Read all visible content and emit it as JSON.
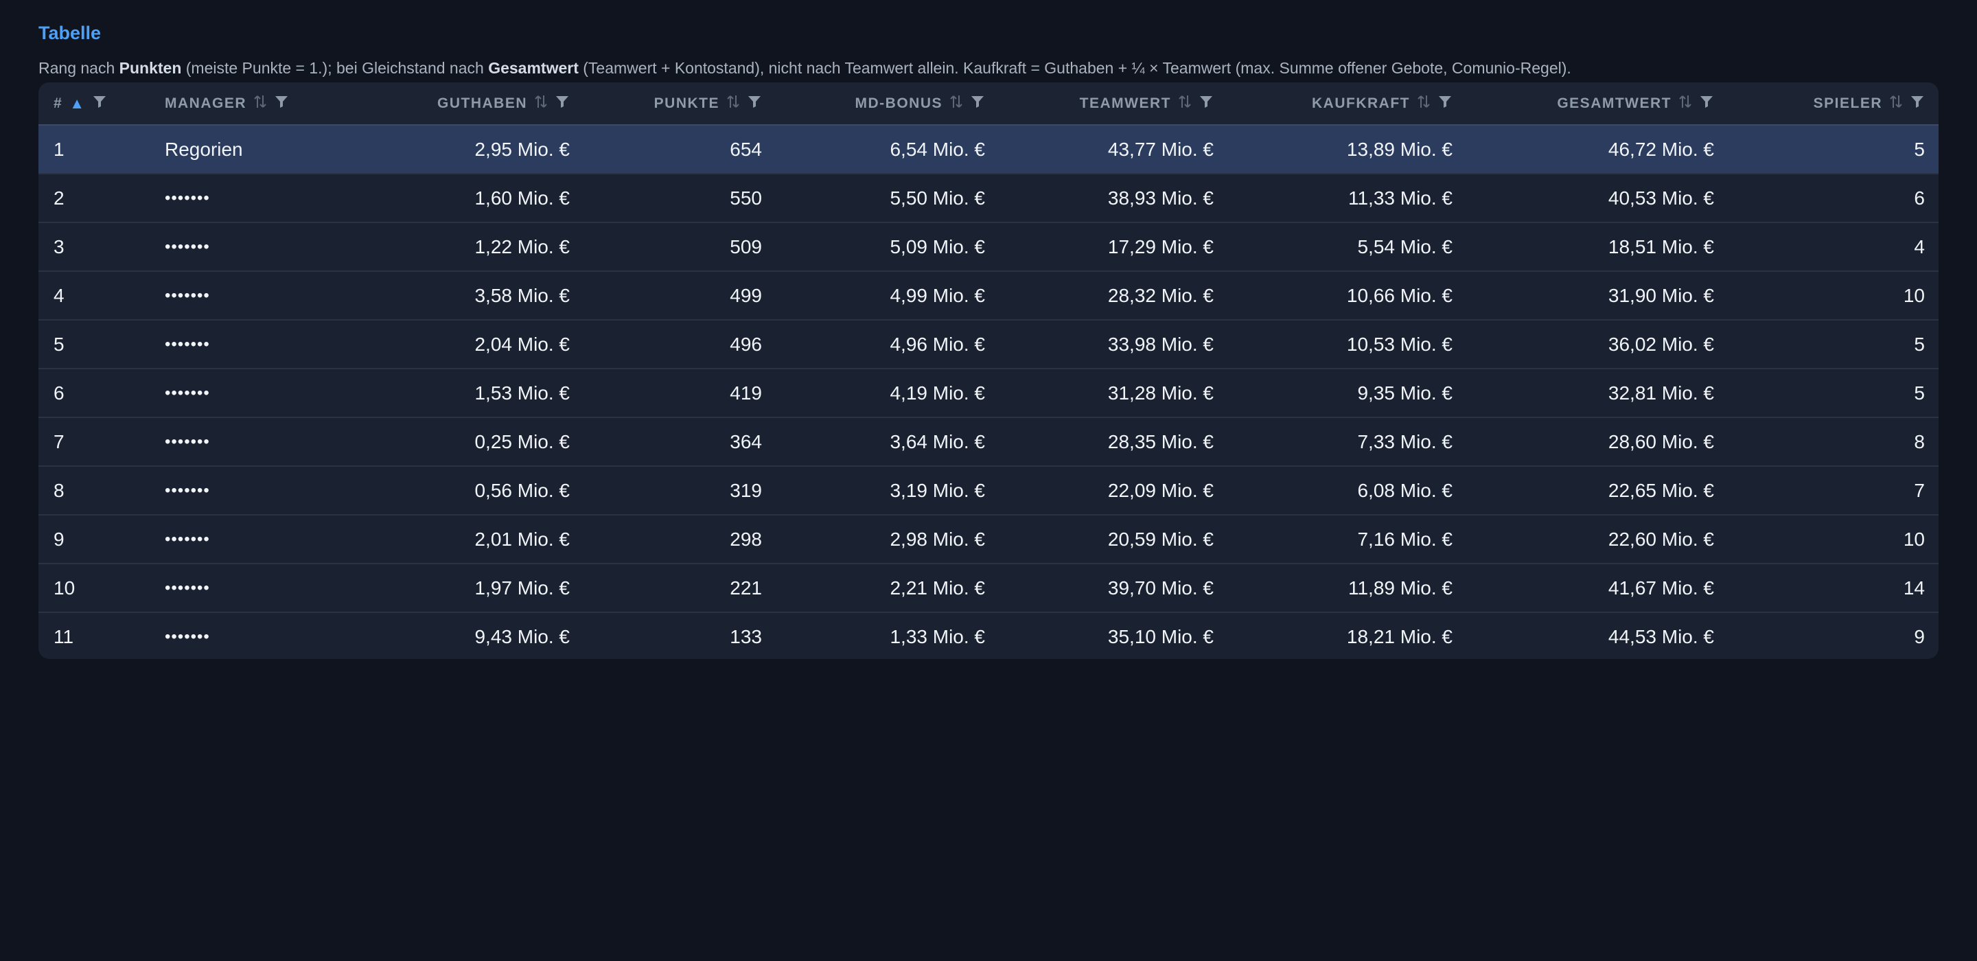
{
  "page": {
    "title": "Tabelle",
    "description": {
      "part1": "Rang nach ",
      "bold1": "Punkten",
      "part2": " (meiste Punkte = 1.); bei Gleichstand nach ",
      "bold2": "Gesamtwert",
      "part3": " (Teamwert + Kontostand), nicht nach Teamwert allein. Kaufkraft = Guthaben + ¼ × Teamwert (max. Summe offener Gebote, Comunio-Regel)."
    }
  },
  "table": {
    "sort": {
      "column": "#",
      "direction": "ascending"
    },
    "columns": [
      {
        "key": "rank",
        "label": "#",
        "align": "left"
      },
      {
        "key": "manager",
        "label": "Manager",
        "align": "left"
      },
      {
        "key": "guthaben",
        "label": "Guthaben",
        "align": "right"
      },
      {
        "key": "punkte",
        "label": "Punkte",
        "align": "right"
      },
      {
        "key": "bonus",
        "label": "MD-Bonus",
        "align": "right"
      },
      {
        "key": "teamwert",
        "label": "Teamwert",
        "align": "right"
      },
      {
        "key": "kaufkraft",
        "label": "Kaufkraft",
        "align": "right"
      },
      {
        "key": "gesamtwert",
        "label": "Gesamtwert",
        "align": "right"
      },
      {
        "key": "spieler",
        "label": "Spieler",
        "align": "right"
      }
    ],
    "rows": [
      {
        "rank": "1",
        "manager": "Regorien",
        "guthaben": "2,95 Mio. €",
        "punkte": "654",
        "bonus": "6,54 Mio. €",
        "teamwert": "43,77 Mio. €",
        "kaufkraft": "13,89 Mio. €",
        "gesamtwert": "46,72 Mio. €",
        "spieler": "5",
        "highlight": true
      },
      {
        "rank": "2",
        "manager": "•••••••",
        "guthaben": "1,60 Mio. €",
        "punkte": "550",
        "bonus": "5,50 Mio. €",
        "teamwert": "38,93 Mio. €",
        "kaufkraft": "11,33 Mio. €",
        "gesamtwert": "40,53 Mio. €",
        "spieler": "6"
      },
      {
        "rank": "3",
        "manager": "•••••••",
        "guthaben": "1,22 Mio. €",
        "punkte": "509",
        "bonus": "5,09 Mio. €",
        "teamwert": "17,29 Mio. €",
        "kaufkraft": "5,54 Mio. €",
        "gesamtwert": "18,51 Mio. €",
        "spieler": "4"
      },
      {
        "rank": "4",
        "manager": "•••••••",
        "guthaben": "3,58 Mio. €",
        "punkte": "499",
        "bonus": "4,99 Mio. €",
        "teamwert": "28,32 Mio. €",
        "kaufkraft": "10,66 Mio. €",
        "gesamtwert": "31,90 Mio. €",
        "spieler": "10"
      },
      {
        "rank": "5",
        "manager": "•••••••",
        "guthaben": "2,04 Mio. €",
        "punkte": "496",
        "bonus": "4,96 Mio. €",
        "teamwert": "33,98 Mio. €",
        "kaufkraft": "10,53 Mio. €",
        "gesamtwert": "36,02 Mio. €",
        "spieler": "5"
      },
      {
        "rank": "6",
        "manager": "•••••••",
        "guthaben": "1,53 Mio. €",
        "punkte": "419",
        "bonus": "4,19 Mio. €",
        "teamwert": "31,28 Mio. €",
        "kaufkraft": "9,35 Mio. €",
        "gesamtwert": "32,81 Mio. €",
        "spieler": "5"
      },
      {
        "rank": "7",
        "manager": "•••••••",
        "guthaben": "0,25 Mio. €",
        "punkte": "364",
        "bonus": "3,64 Mio. €",
        "teamwert": "28,35 Mio. €",
        "kaufkraft": "7,33 Mio. €",
        "gesamtwert": "28,60 Mio. €",
        "spieler": "8"
      },
      {
        "rank": "8",
        "manager": "•••••••",
        "guthaben": "0,56 Mio. €",
        "punkte": "319",
        "bonus": "3,19 Mio. €",
        "teamwert": "22,09 Mio. €",
        "kaufkraft": "6,08 Mio. €",
        "gesamtwert": "22,65 Mio. €",
        "spieler": "7"
      },
      {
        "rank": "9",
        "manager": "•••••••",
        "guthaben": "2,01 Mio. €",
        "punkte": "298",
        "bonus": "2,98 Mio. €",
        "teamwert": "20,59 Mio. €",
        "kaufkraft": "7,16 Mio. €",
        "gesamtwert": "22,60 Mio. €",
        "spieler": "10"
      },
      {
        "rank": "10",
        "manager": "•••••••",
        "guthaben": "1,97 Mio. €",
        "punkte": "221",
        "bonus": "2,21 Mio. €",
        "teamwert": "39,70 Mio. €",
        "kaufkraft": "11,89 Mio. €",
        "gesamtwert": "41,67 Mio. €",
        "spieler": "14"
      },
      {
        "rank": "11",
        "manager": "•••••••",
        "guthaben": "9,43 Mio. €",
        "punkte": "133",
        "bonus": "1,33 Mio. €",
        "teamwert": "35,10 Mio. €",
        "kaufkraft": "18,21 Mio. €",
        "gesamtwert": "44,53 Mio. €",
        "spieler": "9"
      }
    ]
  },
  "icons": {
    "sort_active": "sort-ascending-icon",
    "sort_inactive": "sort-icon",
    "filter": "filter-icon"
  },
  "colors": {
    "background": "#10141f",
    "card": "#1a2130",
    "accent": "#4da0f5",
    "highlight_row": "#2c3c5e",
    "header_text": "#8f9aab"
  }
}
